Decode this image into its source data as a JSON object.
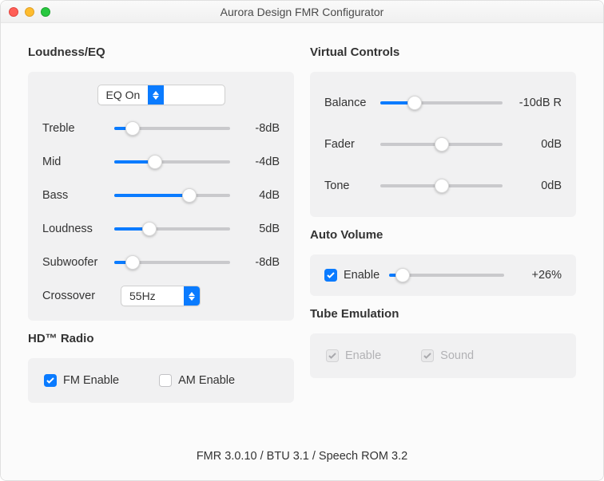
{
  "window": {
    "title": "Aurora Design FMR Configurator"
  },
  "loudness_eq": {
    "title": "Loudness/EQ",
    "eq_select": "EQ On",
    "treble": {
      "label": "Treble",
      "value": "-8dB",
      "pos": 16
    },
    "mid": {
      "label": "Mid",
      "value": "-4dB",
      "pos": 35
    },
    "bass": {
      "label": "Bass",
      "value": "4dB",
      "pos": 65
    },
    "loudness": {
      "label": "Loudness",
      "value": "5dB",
      "pos": 30
    },
    "subwoofer": {
      "label": "Subwoofer",
      "value": "-8dB",
      "pos": 16
    },
    "crossover": {
      "label": "Crossover",
      "value": "55Hz"
    }
  },
  "virtual": {
    "title": "Virtual Controls",
    "balance": {
      "label": "Balance",
      "value": "-10dB R",
      "pos": 28
    },
    "fader": {
      "label": "Fader",
      "value": "0dB",
      "pos": 50
    },
    "tone": {
      "label": "Tone",
      "value": "0dB",
      "pos": 50
    }
  },
  "auto_volume": {
    "title": "Auto Volume",
    "enable_label": "Enable",
    "enabled": true,
    "value": "+26%",
    "pos": 12
  },
  "hd_radio": {
    "title": "HD™ Radio",
    "fm_label": "FM Enable",
    "fm_checked": true,
    "am_label": "AM Enable",
    "am_checked": false
  },
  "tube": {
    "title": "Tube Emulation",
    "enable_label": "Enable",
    "sound_label": "Sound"
  },
  "footer": "FMR 3.0.10  /  BTU 3.1  /  Speech ROM 3.2"
}
